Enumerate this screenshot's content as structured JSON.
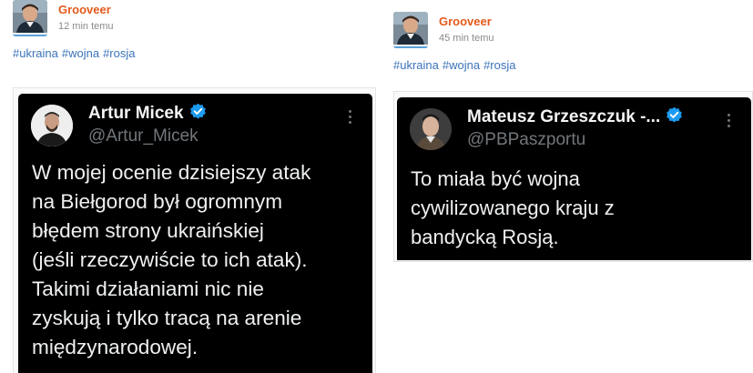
{
  "posts": [
    {
      "author": "Grooveer",
      "time": "12 min temu",
      "tags": [
        "#ukraina",
        "#wojna",
        "#rosja"
      ],
      "tweet": {
        "name": "Artur Micek",
        "handle": "@Artur_Micek",
        "text": "W mojej ocenie dzisiejszy atak\nna Biełgorod był ogromnym\nbłędem strony ukraińskiej\n(jeśli rzeczywiście to ich atak).\nTakimi działaniami nic nie\nzyskują i tylko tracą na arenie\nmiędzynarodowej."
      }
    },
    {
      "author": "Grooveer",
      "time": "45 min temu",
      "tags": [
        "#ukraina",
        "#wojna",
        "#rosja"
      ],
      "tweet": {
        "name": "Mateusz Grzeszczuk -...",
        "handle": "@PBPaszportu",
        "text": "To miała być wojna\ncywilizowanego kraju z\nbandycką Rosją."
      }
    }
  ],
  "icons": {
    "avatar": "user-avatar-icon",
    "verified": "verified-badge-icon",
    "more": "more-options-icon"
  },
  "colors": {
    "author": "#e35a1a",
    "tag": "#3b73b9",
    "tweet_bg": "#000000",
    "verified": "#1d9bf0"
  }
}
